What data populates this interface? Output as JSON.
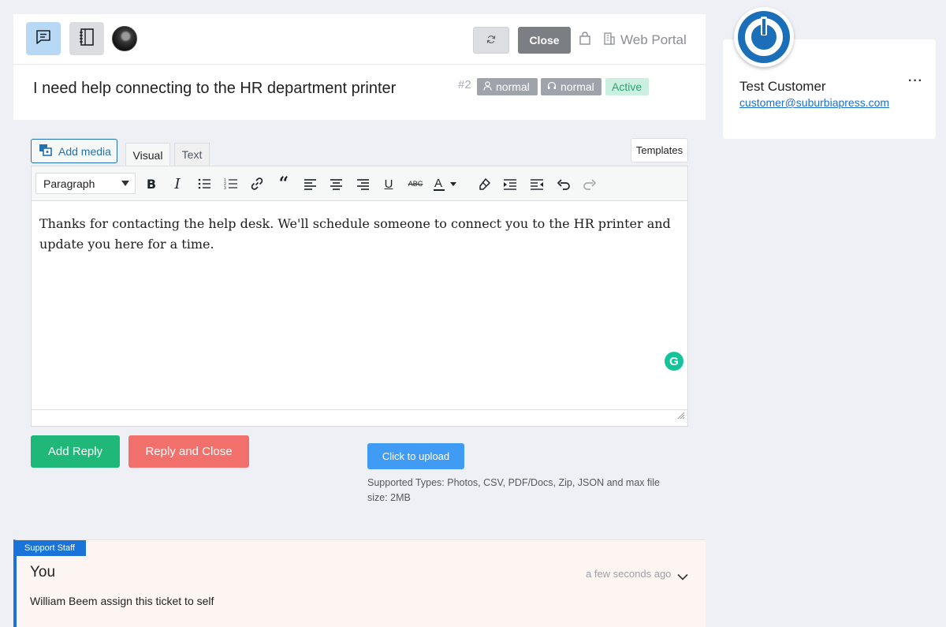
{
  "topbar": {
    "close_label": "Close",
    "web_portal_label": "Web Portal",
    "icons": [
      "chat-icon",
      "notebook-icon",
      "refresh-icon",
      "bag-icon",
      "building-icon"
    ]
  },
  "ticket": {
    "title": "I need help connecting to the HR department printer",
    "number": "#2",
    "priority_customer": "normal",
    "priority_admin": "normal",
    "status": "Active"
  },
  "editor": {
    "add_media_label": "Add media",
    "tabs": {
      "visual": "Visual",
      "text": "Text"
    },
    "templates_label": "Templates",
    "format_selected": "Paragraph",
    "content": "Thanks for contacting the help desk. We'll schedule someone to connect you to the HR printer and update you here for a time.",
    "grammarly_label": "G",
    "toolbar_icons": [
      "bold-icon",
      "italic-icon",
      "bullet-list-icon",
      "numbered-list-icon",
      "link-icon",
      "blockquote-icon",
      "align-left-icon",
      "align-center-icon",
      "align-right-icon",
      "underline-icon",
      "strikethrough-icon",
      "text-color-icon",
      "eraser-icon",
      "indent-icon",
      "outdent-icon",
      "undo-icon",
      "redo-icon"
    ]
  },
  "actions": {
    "add_reply": "Add Reply",
    "reply_and_close": "Reply and Close",
    "upload": "Click to upload",
    "upload_note": "Supported Types: Photos, CSV, PDF/Docs, Zip, JSON and max file size: 2MB"
  },
  "thread": {
    "badge": "Support Staff",
    "author": "You",
    "time": "a few seconds ago",
    "body": "William Beem assign this ticket to self"
  },
  "customer": {
    "name": "Test Customer",
    "email": "customer@suburbiapress.com",
    "more": "···"
  },
  "colors": {
    "accent_blue": "#1a73d8",
    "reply_green": "#1fb879",
    "reply_close_red": "#f2706c",
    "upload_blue": "#409bf5",
    "active_green": "#2ba56e"
  }
}
